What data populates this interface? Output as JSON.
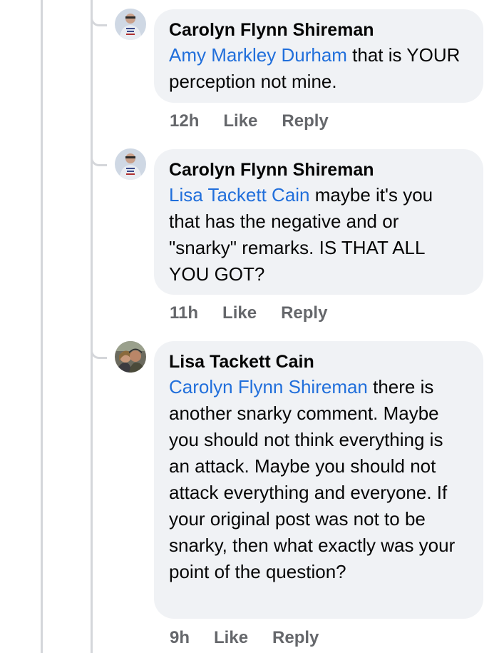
{
  "comments": [
    {
      "author": "Carolyn Flynn Shireman",
      "mention": "Amy Markley Durham",
      "text": " that is YOUR perception not mine.",
      "time": "12h",
      "like": "Like",
      "reply": "Reply",
      "avatar_icon": "avatar-2024-shirt"
    },
    {
      "author": "Carolyn Flynn Shireman",
      "mention": "Lisa Tackett Cain",
      "text": " maybe it's you that has the negative and or \"snarky\" remarks. IS THAT ALL YOU GOT?",
      "time": "11h",
      "like": "Like",
      "reply": "Reply",
      "avatar_icon": "avatar-2024-shirt"
    },
    {
      "author": "Lisa Tackett Cain",
      "mention": "Carolyn Flynn Shireman",
      "text": " there is another snarky comment. Maybe you should not think everything is an attack. Maybe you should not attack everything and everyone. If your original post was not to be snarky, then what exactly was your point of the question?",
      "time": "9h",
      "like": "Like",
      "reply": "Reply",
      "avatar_icon": "avatar-couple-photo"
    }
  ],
  "colors": {
    "bubble": "#f0f2f5",
    "mention": "#216fdb",
    "meta": "#65676b",
    "thread_line": "#d4d6da"
  }
}
